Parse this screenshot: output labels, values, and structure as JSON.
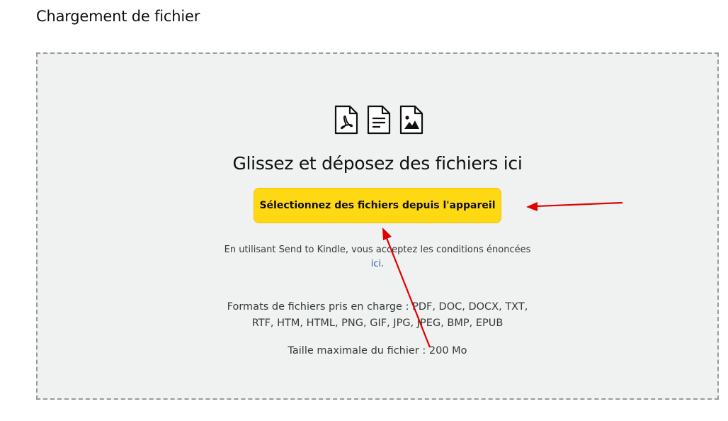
{
  "page": {
    "title": "Chargement de fichier"
  },
  "dropzone": {
    "icons": [
      "pdf-file-icon",
      "document-file-icon",
      "image-file-icon"
    ],
    "heading": "Glissez et déposez des fichiers ici",
    "select_button_label": "Sélectionnez des fichiers depuis l'appareil",
    "terms_text": "En utilisant Send to Kindle, vous acceptez les conditions énoncées",
    "terms_link": "ici",
    "terms_end": ".",
    "formats_text": "Formats de fichiers pris en charge : PDF, DOC, DOCX, TXT, RTF, HTM, HTML, PNG, GIF, JPG, JPEG, BMP, EPUB",
    "max_size_text": "Taille maximale du fichier : 200 Mo"
  },
  "colors": {
    "button_bg": "#ffd814",
    "dropzone_bg": "#f0f1f1",
    "link": "#2162a1",
    "annotation_arrow": "#e00000"
  }
}
